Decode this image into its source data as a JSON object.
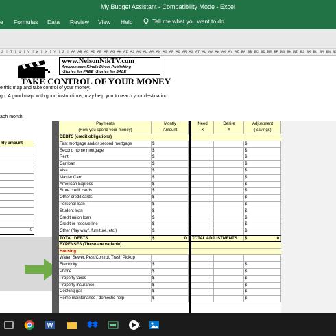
{
  "window": {
    "title": "My Budget Assistant  -  Compatibility Mode  -  Excel"
  },
  "ribbon": {
    "tabs": [
      "e",
      "Formulas",
      "Data",
      "Review",
      "View",
      "Help"
    ],
    "tellme_placeholder": "Tell me what you want to do"
  },
  "column_headers": "S | T | U | V | W | X | Y | Z | AA AB AC AD AE AF AG AH AI AJ AK AL AM AN AO AP AQ AR AS AT AU AV AW AX AY AZ BA BB BC BD BE BF BG BH BI BJ BK BL BM BN BO BP BQ BR BS BT BU BV",
  "header": {
    "site": "www.NelsonNikTV.com",
    "lines": [
      "Amazon.com Kindle Direct Publishing",
      "-Stories for FREE -Stories for SALE"
    ],
    "headline": "TAKE CONTROL OF YOUR MONEY",
    "intro1": "e this map and take control of your money.",
    "intro2": "go. A good map, with good instructions, may help you to reach your destination.",
    "month_note": "ach month."
  },
  "left_table": {
    "header": "hly amount",
    "total": "0"
  },
  "table": {
    "headers": {
      "payments": "Payments\n(How you spend your money)",
      "monthly": "Montly\nAmount",
      "need": "Need\nX",
      "desire": "Desire\nX",
      "adjustment": "Adjustment\n(Savings)"
    },
    "debts_section": "DEBTS (credit obligations)",
    "debt_rows": [
      "First mortgage and/or second mortgage",
      "Second home mortgage",
      "Rent",
      "Car loan",
      "Visa",
      "Master Card",
      "American Express",
      "Store credit cards",
      "Other credit cards",
      "Personal loan",
      "Student loan",
      "Credit union loan",
      "Credit or reserve line",
      "Other (\"lay way\", furniture, etc.)"
    ],
    "total_debts": "TOTAL DEBTS",
    "total_adjustments": "TOTAL ADJUSTMENTS",
    "zero": "0",
    "currency": "$",
    "expenses_section": "EXPENSES (These are variable)",
    "housing": "Housing",
    "expense_rows": [
      "Water, Sewer, Pest Control, Trash Pickup",
      "Electricity",
      "Phone",
      "Property taxes",
      "Property insurance",
      "Cooking gas",
      "Home maintanance / domestic help"
    ]
  },
  "taskbar": {
    "excel_label": "X"
  }
}
